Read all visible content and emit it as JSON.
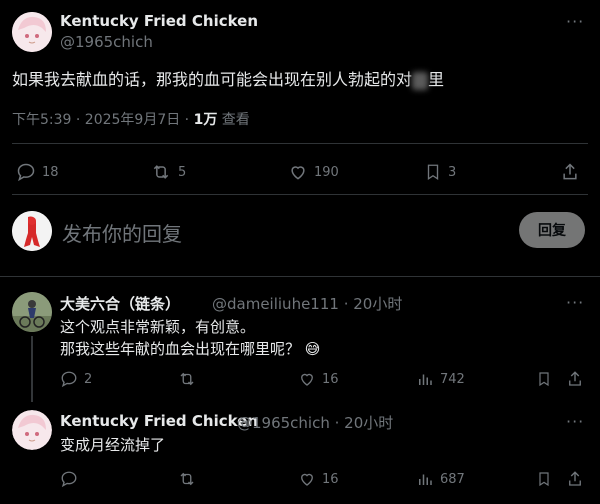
{
  "main_post": {
    "author_name": "Kentucky Fried Chicken",
    "author_handle": "@1965chich",
    "text_before": "如果我去献血的话，那我的血可能会出现在别人勃起的对",
    "text_after": "里",
    "time": "下午5:39 · 2025年9月7日 ·",
    "views_count": "1万",
    "views_label": "查看",
    "replies": "18",
    "retweets": "5",
    "likes": "190",
    "bookmarks": "3"
  },
  "composer": {
    "placeholder": "发布你的回复",
    "reply_button": "回复"
  },
  "replies": [
    {
      "author_name": "大美六合（链条）",
      "author_handle": "@dameiliuhe111 · 20小时",
      "line1": "这个观点非常新颖，有创意。",
      "line2": "那我这些年献的血会出现在哪里呢？",
      "emoji": "😅",
      "replies": "2",
      "retweets": "",
      "likes": "16",
      "views": "742"
    },
    {
      "author_name": "Kentucky Fried Chicken",
      "author_handle": "@1965chich · 20小时",
      "line1": "变成月经流掉了",
      "replies": "",
      "retweets": "",
      "likes": "16",
      "views": "687"
    }
  ],
  "icons": {
    "more": "more-dots-icon",
    "reply": "reply-icon",
    "retweet": "retweet-icon",
    "like": "heart-icon",
    "bookmark": "bookmark-icon",
    "share": "share-icon",
    "views": "views-icon"
  },
  "colors": {
    "background": "#000000",
    "text": "#e7e9ea",
    "muted": "#71767b",
    "divider": "#2f3336"
  }
}
